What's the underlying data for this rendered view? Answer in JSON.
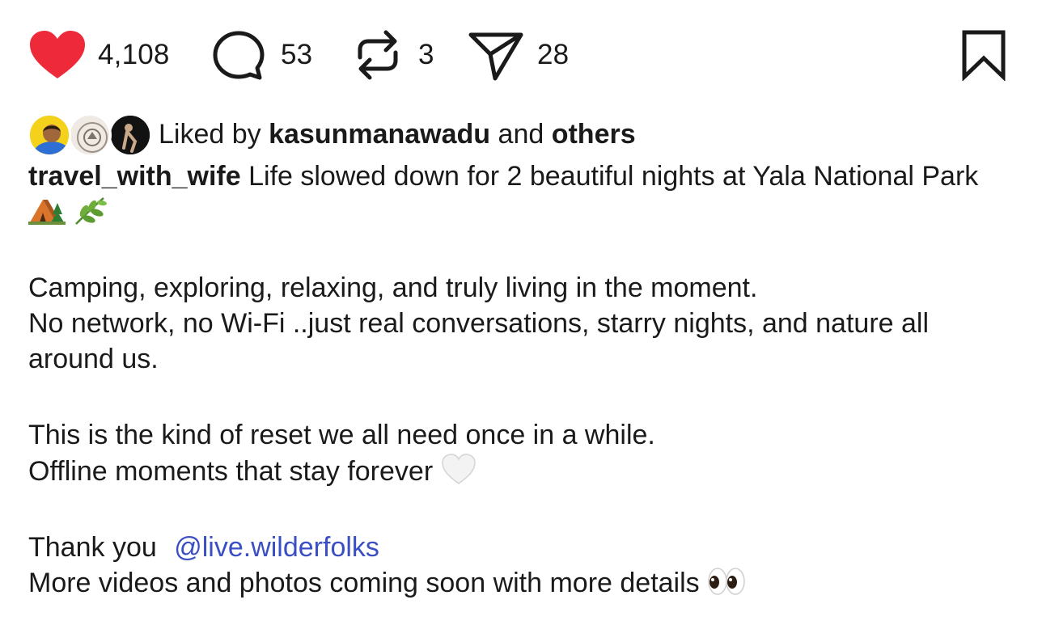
{
  "actions": {
    "like_count": "4,108",
    "comment_count": "53",
    "repost_count": "3",
    "share_count": "28",
    "like_color": "#ee2a3a"
  },
  "liked_by": {
    "prefix": "Liked by",
    "user": "kasunmanawadu",
    "conjunction": "and",
    "others": "others"
  },
  "caption": {
    "username": "travel_with_wife",
    "line1": "Life slowed down for 2 beautiful nights at Yala National Park",
    "line2": "Camping, exploring, relaxing, and truly living in the moment.",
    "line3": "No network, no Wi-Fi ..just real conversations, starry nights, and nature all around us.",
    "line4": "This is the kind of reset we all need once in a while.",
    "line5": "Offline moments that stay forever",
    "thanks": "Thank you",
    "mention": "@live.wilderfolks",
    "line6": "More videos and photos coming soon with more details"
  },
  "icons": [
    "heart-icon",
    "comment-icon",
    "repost-icon",
    "share-icon",
    "bookmark-icon",
    "tent-emoji",
    "tree-emoji",
    "herb-emoji",
    "white-heart-emoji",
    "eyes-emoji"
  ]
}
